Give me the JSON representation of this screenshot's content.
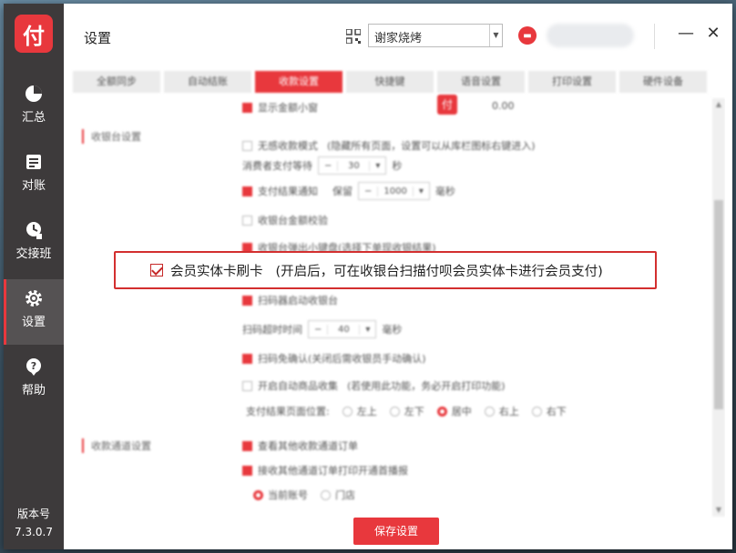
{
  "window": {
    "title": "设置",
    "store_select_value": "谢家烧烤",
    "minimize_label": "—",
    "close_label": "✕"
  },
  "sidebar": {
    "logo": "付",
    "items": [
      {
        "label": "汇总",
        "icon": "pie-chart-icon"
      },
      {
        "label": "对账",
        "icon": "ledger-icon"
      },
      {
        "label": "交接班",
        "icon": "handover-icon"
      },
      {
        "label": "设置",
        "icon": "gear-icon",
        "active": true
      },
      {
        "label": "帮助",
        "icon": "help-icon"
      }
    ],
    "version_label": "版本号",
    "version_value": "7.3.0.7"
  },
  "tabs": [
    {
      "label": "全额同步"
    },
    {
      "label": "自动结账"
    },
    {
      "label": "收款设置",
      "active": true
    },
    {
      "label": "快捷键"
    },
    {
      "label": "语音设置"
    },
    {
      "label": "打印设置"
    },
    {
      "label": "硬件设备"
    }
  ],
  "settings": {
    "show_total_window": "显示金额小窗",
    "amount": "0.00",
    "cashier_section": "收银台设置",
    "silent_mode": "无感收款模式",
    "silent_mode_note": "(隐藏所有页面，设置可以从库栏图标右键进入)",
    "consumer_wait_label": "消费者支付等待",
    "consumer_wait_value": "30",
    "consumer_wait_unit": "秒",
    "pay_result_notify": "支付结果通知",
    "keep_label": "保留",
    "keep_value": "1000",
    "keep_unit": "毫秒",
    "full_verify": "收银台金额校验",
    "popup_keyboard": "收银台弹出小键盘",
    "popup_keyboard_note": "(选择下单现收银结果)",
    "scan_start": "扫码器启动收银台",
    "scan_timeout_label": "扫码超时时间",
    "scan_timeout_value": "40",
    "scan_timeout_unit": "毫秒",
    "scan_confirm": "扫码免确认",
    "scan_confirm_note": "(关闭后需收银员手动确认)",
    "auto_goods": "开启自动商品收集",
    "auto_goods_note": "(若使用此功能，务必开启打印功能)",
    "result_pos_label": "支付结果页面位置:",
    "result_positions": [
      "左上",
      "左下",
      "居中",
      "右上",
      "右下"
    ],
    "channel_section": "收款通道设置",
    "view_other_orders": "查看其他收款通道订单",
    "receive_other_orders": "接收其他通道订单打印开通首播报",
    "current_account": "当前账号",
    "store_option": "门店",
    "save_button": "保存设置"
  },
  "callout": {
    "label": "会员实体卡刷卡",
    "note": "(开启后，可在收银台扫描付呗会员实体卡进行会员支付)",
    "checked": true
  },
  "colors": {
    "accent": "#e8383d",
    "sidebar_bg": "#3d3a3b",
    "callout_border": "#d32f2f"
  }
}
